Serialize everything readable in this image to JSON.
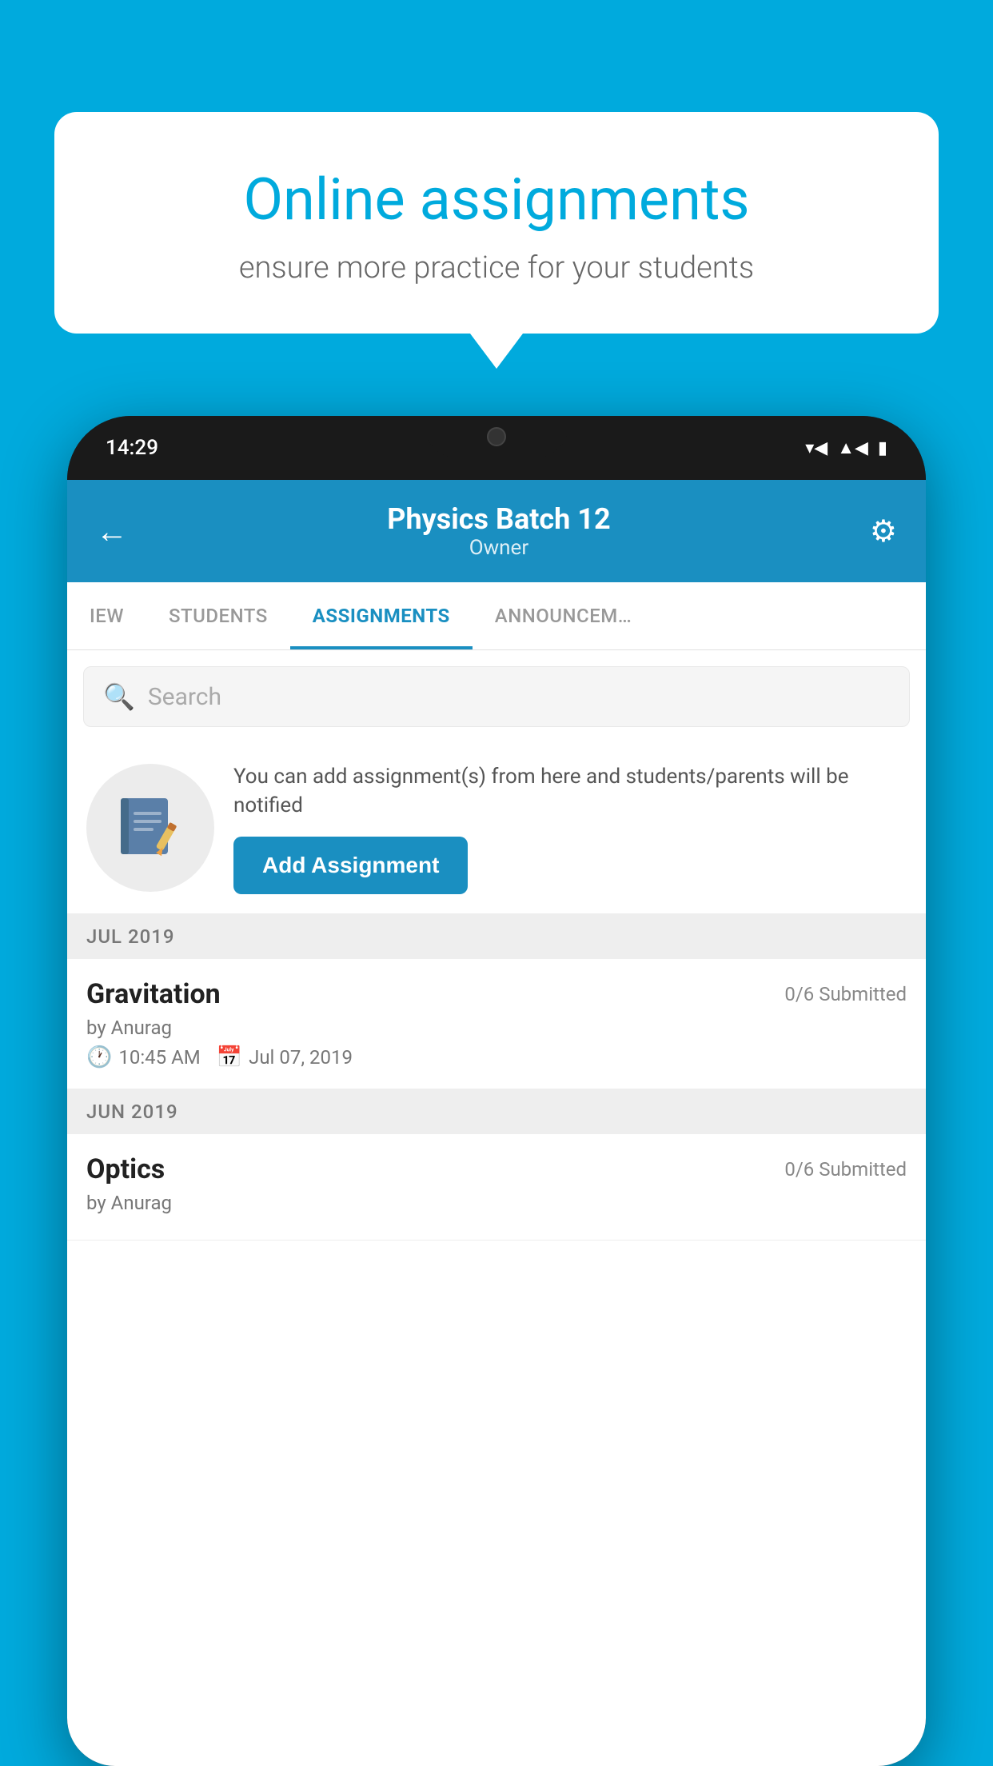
{
  "background_color": "#00AADD",
  "speech_bubble": {
    "title": "Online assignments",
    "subtitle": "ensure more practice for your students"
  },
  "status_bar": {
    "time": "14:29",
    "wifi_icon": "wifi",
    "signal_icon": "signal",
    "battery_icon": "battery"
  },
  "app_header": {
    "title": "Physics Batch 12",
    "subtitle": "Owner",
    "back_label": "←",
    "settings_label": "⚙"
  },
  "tabs": [
    {
      "label": "IEW",
      "active": false
    },
    {
      "label": "STUDENTS",
      "active": false
    },
    {
      "label": "ASSIGNMENTS",
      "active": true
    },
    {
      "label": "ANNOUNCEM…",
      "active": false
    }
  ],
  "search": {
    "placeholder": "Search"
  },
  "promo": {
    "description": "You can add assignment(s) from here and students/parents will be notified",
    "button_label": "Add Assignment"
  },
  "months": [
    {
      "label": "JUL 2019",
      "assignments": [
        {
          "name": "Gravitation",
          "submitted": "0/6 Submitted",
          "by": "by Anurag",
          "time": "10:45 AM",
          "date": "Jul 07, 2019"
        }
      ]
    },
    {
      "label": "JUN 2019",
      "assignments": [
        {
          "name": "Optics",
          "submitted": "0/6 Submitted",
          "by": "by Anurag",
          "time": "",
          "date": ""
        }
      ]
    }
  ]
}
